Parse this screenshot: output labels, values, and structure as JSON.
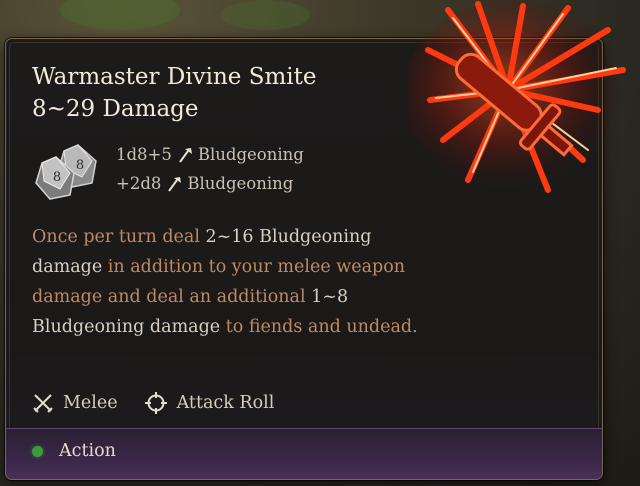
{
  "spell": {
    "name": "Warmaster Divine Smite",
    "damage_range": "8~29 Damage"
  },
  "damage_rolls": [
    {
      "dice": "1d8+5",
      "type": "Bludgeoning"
    },
    {
      "dice": "+2d8",
      "type": "Bludgeoning"
    }
  ],
  "dice_icon": {
    "face_value": "8",
    "icon": "d8-dice-icon"
  },
  "description": {
    "p1": "Once per turn deal ",
    "v1": "2~16 Bludgeoning",
    "nl": "damage",
    "p2": " in addition to your melee weapon damage and deal an additional ",
    "v2": "1~8 Bludgeoning damage",
    "p3": " to fiends and undead."
  },
  "tags": [
    {
      "label": "Melee",
      "icon": "crossed-swords-icon"
    },
    {
      "label": "Attack Roll",
      "icon": "crosshair-icon"
    }
  ],
  "cost": {
    "label": "Action",
    "icon": "action-dot-icon",
    "color": "#3e9a3e"
  },
  "colors": {
    "title": "#f4ead8",
    "description": "#c08a64",
    "highlight": "#d8d0c2",
    "border": "#7d6a4c",
    "glow": "#ff3a10"
  }
}
